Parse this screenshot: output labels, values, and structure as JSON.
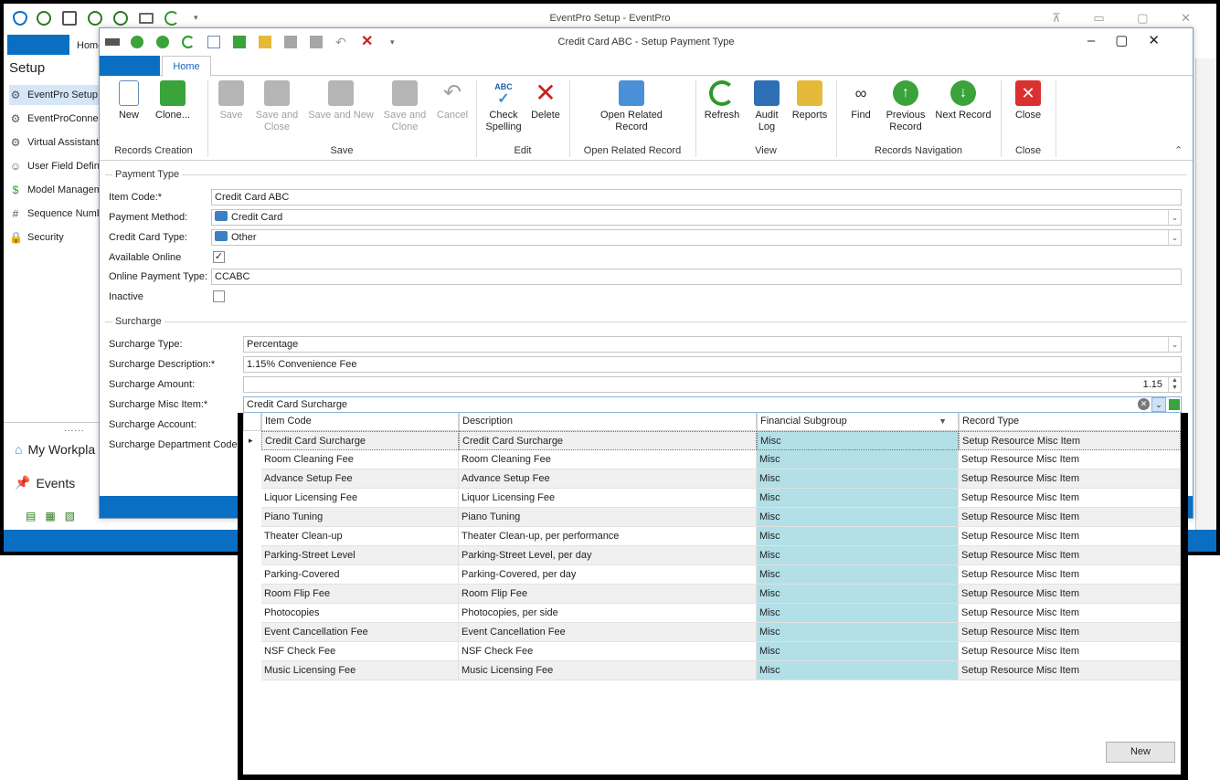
{
  "outer_window": {
    "title": "EventPro Setup - EventPro",
    "home_tab": "Home",
    "sidebar_title": "Setup",
    "sidebar_items": [
      {
        "label": "EventPro Setup",
        "icon": "gear-icon"
      },
      {
        "label": "EventProConne",
        "icon": "gear-icon"
      },
      {
        "label": "Virtual Assistant",
        "icon": "gear-icon"
      },
      {
        "label": "User Field Defin",
        "icon": "user-icon"
      },
      {
        "label": "Model Managem",
        "icon": "money-icon"
      },
      {
        "label": "Sequence Numb",
        "icon": "hash-icon"
      },
      {
        "label": "Security",
        "icon": "lock-icon"
      }
    ],
    "splitter": "......",
    "nav_items": [
      {
        "label": "My Workpla",
        "icon": "home-icon"
      },
      {
        "label": "Events",
        "icon": "pin-icon"
      }
    ]
  },
  "child_window": {
    "title": "Credit Card ABC - Setup Payment Type",
    "home_tab": "Home",
    "ribbon": {
      "new": "New",
      "clone": "Clone...",
      "save": "Save",
      "save_close_1": "Save and",
      "save_close_2": "Close",
      "save_new": "Save and New",
      "save_clone_1": "Save and",
      "save_clone_2": "Clone",
      "cancel": "Cancel",
      "check_1": "Check",
      "check_2": "Spelling",
      "check_abc": "ABC",
      "delete": "Delete",
      "open_rel_1": "Open Related",
      "open_rel_2": "Record",
      "refresh": "Refresh",
      "audit_1": "Audit",
      "audit_2": "Log",
      "reports": "Reports",
      "find": "Find",
      "prev_1": "Previous",
      "prev_2": "Record",
      "next": "Next Record",
      "close": "Close",
      "groups": {
        "records_creation": "Records Creation",
        "save": "Save",
        "edit": "Edit",
        "open_related": "Open Related Record",
        "view": "View",
        "records_navigation": "Records Navigation",
        "close": "Close"
      }
    },
    "payment_type": {
      "legend": "Payment Type",
      "item_code_label": "Item Code:*",
      "item_code": "Credit Card ABC",
      "payment_method_label": "Payment Method:",
      "payment_method": "Credit Card",
      "cc_type_label": "Credit Card Type:",
      "cc_type": "Other",
      "available_online_label": "Available Online",
      "available_online_mark": "✓",
      "online_payment_type_label": "Online Payment Type:",
      "online_payment_type": "CCABC",
      "inactive_label": "Inactive"
    },
    "surcharge": {
      "legend": "Surcharge",
      "type_label": "Surcharge Type:",
      "type": "Percentage",
      "desc_label": "Surcharge Description:*",
      "desc": "1.15% Convenience Fee",
      "amount_label": "Surcharge Amount:",
      "amount": "1.15",
      "misc_label": "Surcharge Misc Item:*",
      "misc": "Credit Card Surcharge",
      "account_label": "Surcharge Account:",
      "dept_label": "Surcharge Department Code:"
    }
  },
  "dropdown_grid": {
    "columns": [
      "Item Code",
      "Description",
      "Financial Subgroup",
      "Record Type"
    ],
    "rows": [
      [
        "Credit Card Surcharge",
        "Credit Card Surcharge",
        "Misc",
        "Setup Resource Misc Item"
      ],
      [
        "Room Cleaning Fee",
        "Room Cleaning Fee",
        "Misc",
        "Setup Resource Misc Item"
      ],
      [
        "Advance Setup Fee",
        "Advance Setup Fee",
        "Misc",
        "Setup Resource Misc Item"
      ],
      [
        "Liquor Licensing Fee",
        "Liquor Licensing Fee",
        "Misc",
        "Setup Resource Misc Item"
      ],
      [
        "Piano Tuning",
        "Piano Tuning",
        "Misc",
        "Setup Resource Misc Item"
      ],
      [
        "Theater Clean-up",
        "Theater Clean-up, per performance",
        "Misc",
        "Setup Resource Misc Item"
      ],
      [
        "Parking-Street Level",
        "Parking-Street Level, per day",
        "Misc",
        "Setup Resource Misc Item"
      ],
      [
        "Parking-Covered",
        "Parking-Covered, per day",
        "Misc",
        "Setup Resource Misc Item"
      ],
      [
        "Room Flip Fee",
        "Room Flip Fee",
        "Misc",
        "Setup Resource Misc Item"
      ],
      [
        "Photocopies",
        "Photocopies, per side",
        "Misc",
        "Setup Resource Misc Item"
      ],
      [
        "Event Cancellation Fee",
        "Event Cancellation Fee",
        "Misc",
        "Setup Resource Misc Item"
      ],
      [
        "NSF Check Fee",
        "NSF Check Fee",
        "Misc",
        "Setup Resource Misc Item"
      ],
      [
        "Music Licensing Fee",
        "Music Licensing Fee",
        "Misc",
        "Setup Resource Misc Item"
      ]
    ],
    "new_button": "New",
    "misc_color": "#b3dfe6"
  }
}
